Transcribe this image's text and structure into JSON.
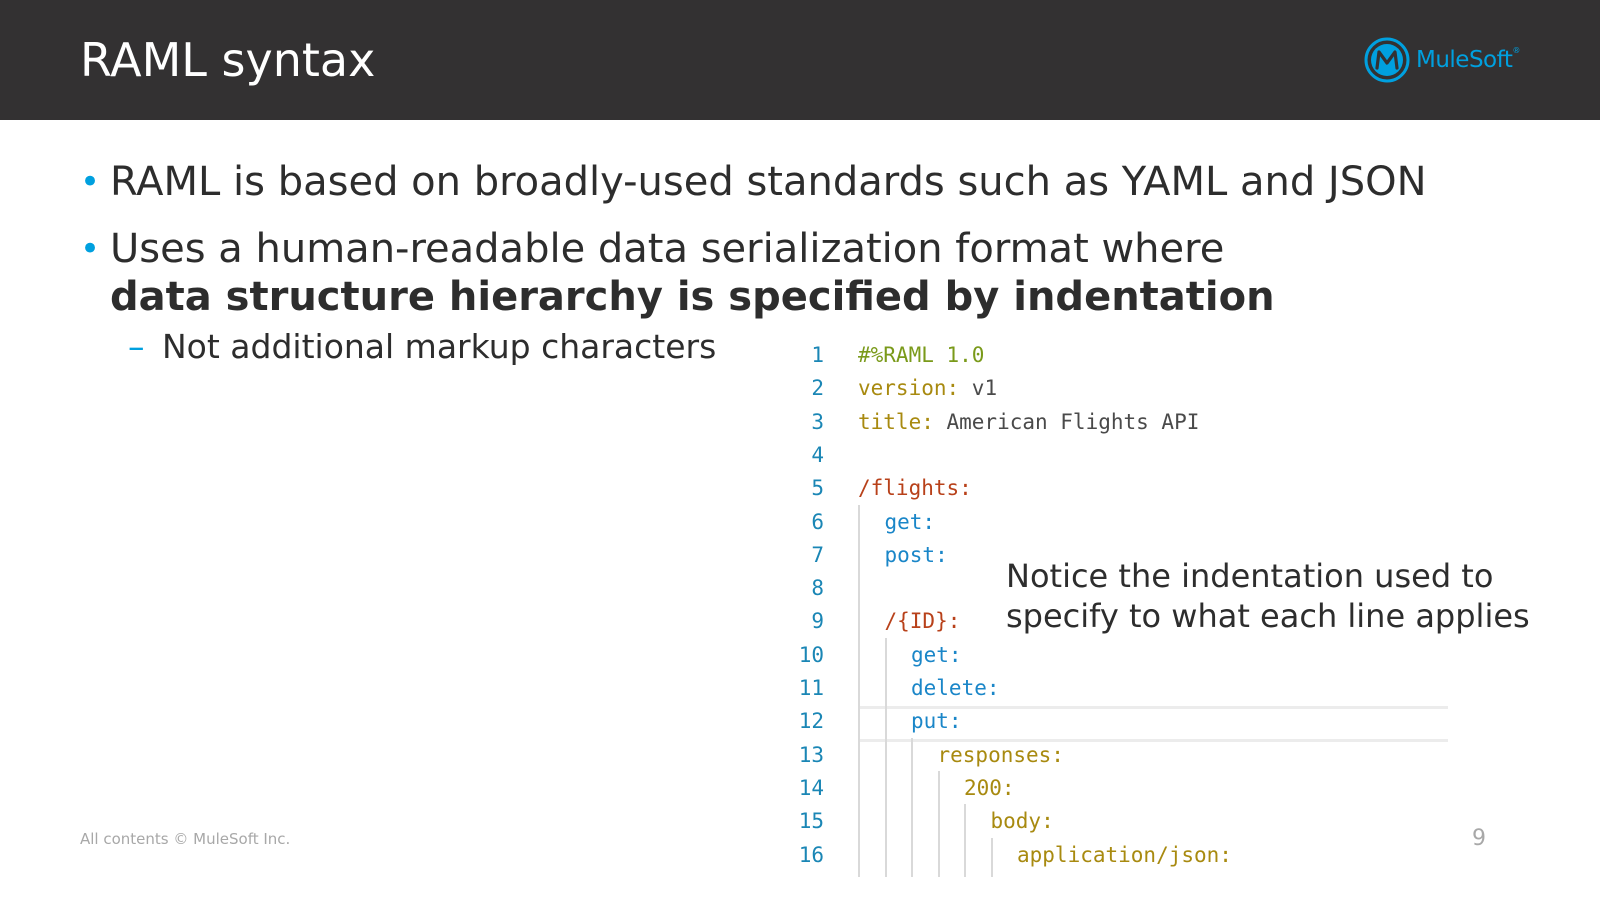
{
  "slide": {
    "title": "RAML syntax",
    "logo_text": "MuleSoft",
    "logo_tm": "®"
  },
  "bullets": [
    {
      "text": "RAML is based on broadly-used standards such as YAML and JSON"
    },
    {
      "text": "Uses a human-readable data serialization format where",
      "bold_text": "data structure hierarchy is specified by indentation"
    }
  ],
  "sub_bullet": {
    "marker": "–",
    "text": "Not additional markup characters"
  },
  "bullet_marker": "•",
  "code": {
    "lines": [
      {
        "num": "1",
        "parts": [
          [
            "meta",
            "#%RAML 1.0"
          ]
        ],
        "indent": 0
      },
      {
        "num": "2",
        "parts": [
          [
            "key",
            "version:"
          ],
          [
            "val",
            " v1"
          ]
        ],
        "indent": 0
      },
      {
        "num": "3",
        "parts": [
          [
            "key",
            "title:"
          ],
          [
            "val",
            " American Flights API"
          ]
        ],
        "indent": 0
      },
      {
        "num": "4",
        "parts": [],
        "indent": 0
      },
      {
        "num": "5",
        "parts": [
          [
            "res",
            "/flights:"
          ]
        ],
        "indent": 0
      },
      {
        "num": "6",
        "parts": [
          [
            "meth",
            "get:"
          ]
        ],
        "indent": 1
      },
      {
        "num": "7",
        "parts": [
          [
            "meth",
            "post:"
          ]
        ],
        "indent": 1
      },
      {
        "num": "8",
        "parts": [],
        "indent": 1
      },
      {
        "num": "9",
        "parts": [
          [
            "res",
            "/{ID}:"
          ]
        ],
        "indent": 1
      },
      {
        "num": "10",
        "parts": [
          [
            "meth",
            "get:"
          ]
        ],
        "indent": 2
      },
      {
        "num": "11",
        "parts": [
          [
            "meth",
            "delete:"
          ]
        ],
        "indent": 2
      },
      {
        "num": "12",
        "parts": [
          [
            "meth",
            "put:"
          ]
        ],
        "indent": 2
      },
      {
        "num": "13",
        "parts": [
          [
            "key",
            "responses:"
          ]
        ],
        "indent": 3
      },
      {
        "num": "14",
        "parts": [
          [
            "key",
            "200:"
          ]
        ],
        "indent": 4
      },
      {
        "num": "15",
        "parts": [
          [
            "key",
            "body:"
          ]
        ],
        "indent": 5
      },
      {
        "num": "16",
        "parts": [
          [
            "key",
            "application/json:"
          ]
        ],
        "indent": 6
      }
    ]
  },
  "note": {
    "line1": "Notice the indentation used to",
    "line2": "specify to what each line applies"
  },
  "footer": {
    "copyright": "All contents © MuleSoft Inc.",
    "page_number": "9"
  }
}
